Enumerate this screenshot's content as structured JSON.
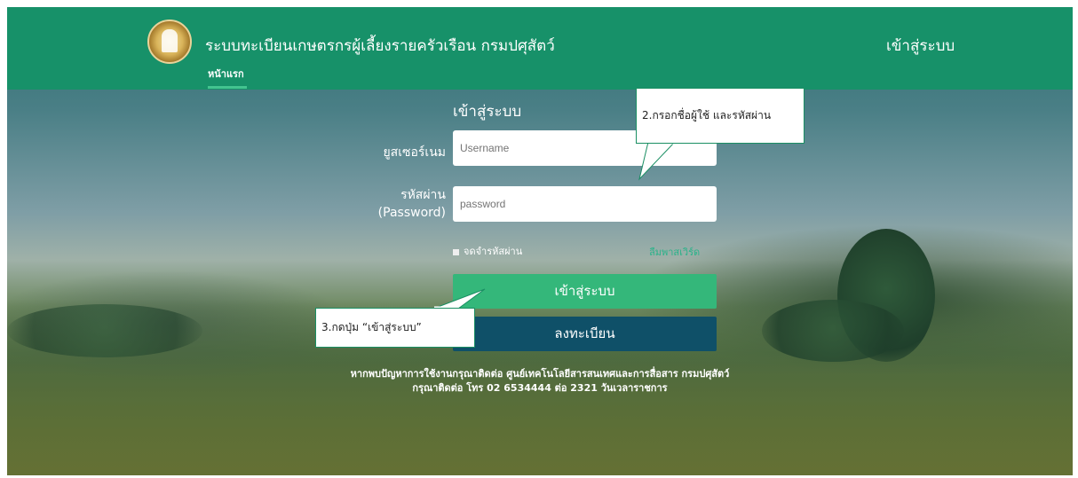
{
  "header": {
    "title": "ระบบทะเบียนเกษตรกรผู้เลี้ยงรายครัวเรือน กรมปศุสัตว์",
    "nav_home": "หน้าแรก",
    "nav_login": "เข้าสู่ระบบ",
    "logo_icon": "department-seal-icon",
    "color": "#179169"
  },
  "form": {
    "title": "เข้าสู่ระบบ",
    "username_label": "ยูสเซอร์เนม",
    "username_placeholder": "Username",
    "password_label_line1": "รหัสผ่าน",
    "password_label_line2": "(Password)",
    "password_placeholder": "password",
    "remember_label": "จดจำรหัสผ่าน",
    "forgot_link": "ลืมพาสเวิร์ด",
    "login_button": "เข้าสู่ระบบ",
    "register_button": "ลงทะเบียน",
    "login_color": "#34b77a",
    "register_color": "#0f5068"
  },
  "footer": {
    "line1": "หากพบปัญหาการใช้งานกรุณาติดต่อ ศูนย์เทคโนโลยีสารสนเทศและการสื่อสาร กรมปศุสัตว์",
    "line2": "กรุณาติดต่อ โทร 02 6534444 ต่อ 2321 วันเวลาราชการ"
  },
  "annotations": {
    "step2": "2.กรอกชื่อผู้ใช้ และรหัสผ่าน",
    "step3": "3.กดปุ่ม “เข้าสู่ระบบ”"
  }
}
